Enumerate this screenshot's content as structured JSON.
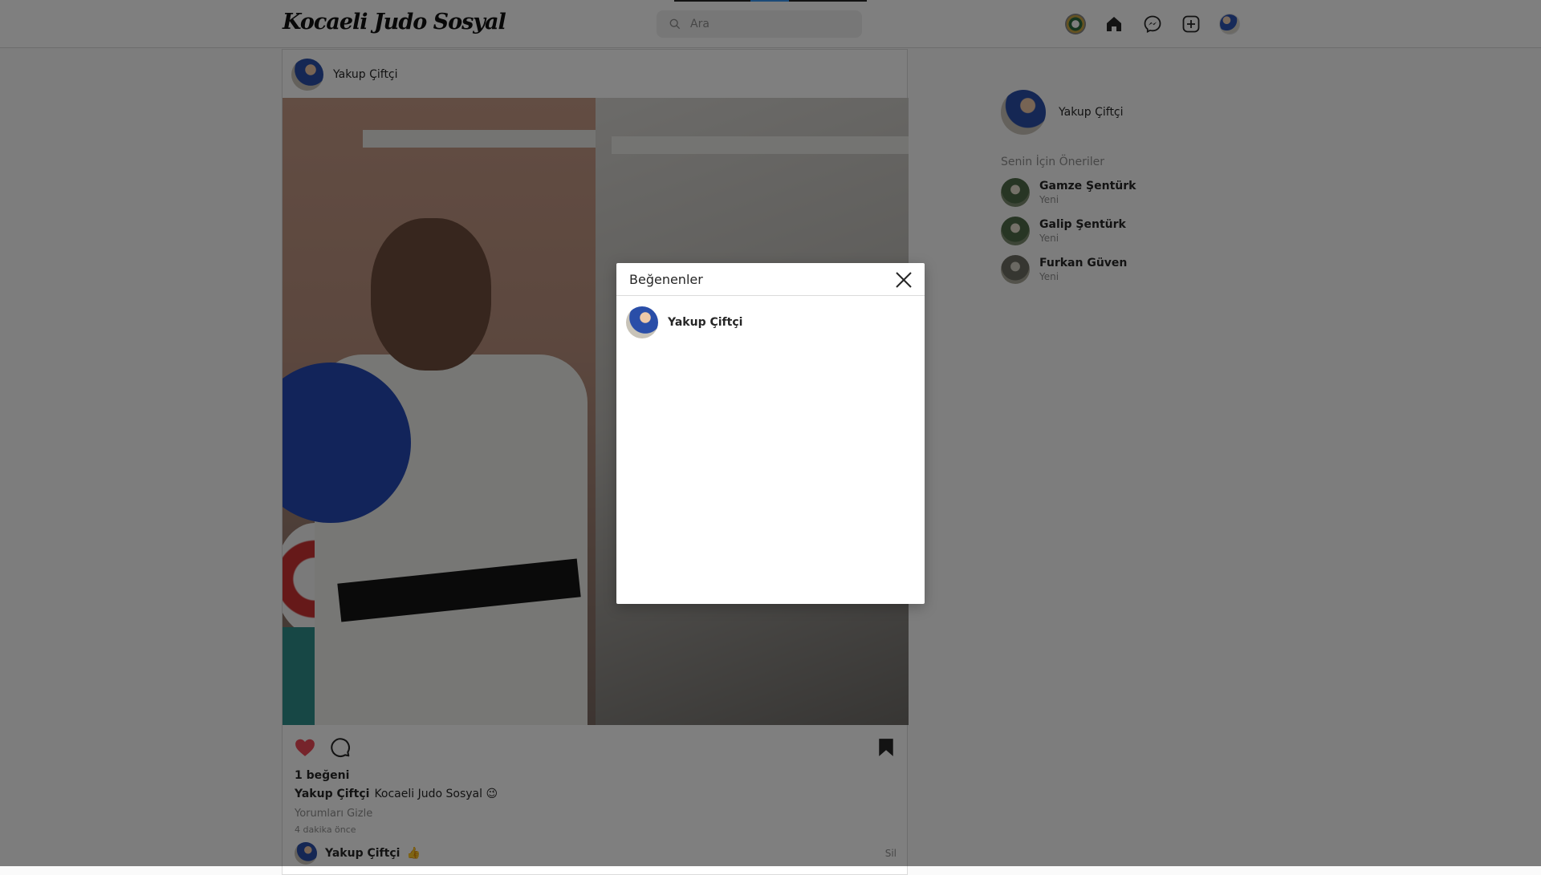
{
  "header": {
    "logo": "Kocaeli Judo Sosyal",
    "search_placeholder": "Ara",
    "icons": [
      "federation-emblem-icon",
      "home-icon",
      "messenger-icon",
      "new-post-icon",
      "profile-avatar"
    ]
  },
  "post": {
    "author": "Yakup Çiftçi",
    "likes_text": "1 beğeni",
    "caption_user": "Yakup Çiftçi",
    "caption_text": "Kocaeli Judo Sosyal 😉",
    "hide_comments": "Yorumları Gizle",
    "time": "4 dakika önce",
    "comment": {
      "user": "Yakup Çiftçi",
      "text": "👍",
      "delete_label": "Sil"
    },
    "liked": true,
    "like_color": "#ed4956"
  },
  "sidebar": {
    "username": "Yakup Çiftçi",
    "suggestions_title": "Senin İçin Öneriler",
    "suggestions": [
      {
        "name": "Gamze Şentürk",
        "sub": "Yeni"
      },
      {
        "name": "Galip Şentürk",
        "sub": "Yeni"
      },
      {
        "name": "Furkan Güven",
        "sub": "Yeni"
      }
    ]
  },
  "modal": {
    "title": "Beğenenler",
    "likers": [
      {
        "name": "Yakup Çiftçi"
      }
    ]
  },
  "colors": {
    "accent": "#3897f0",
    "muted": "#8e8e8e",
    "border": "#dbdbdb"
  }
}
